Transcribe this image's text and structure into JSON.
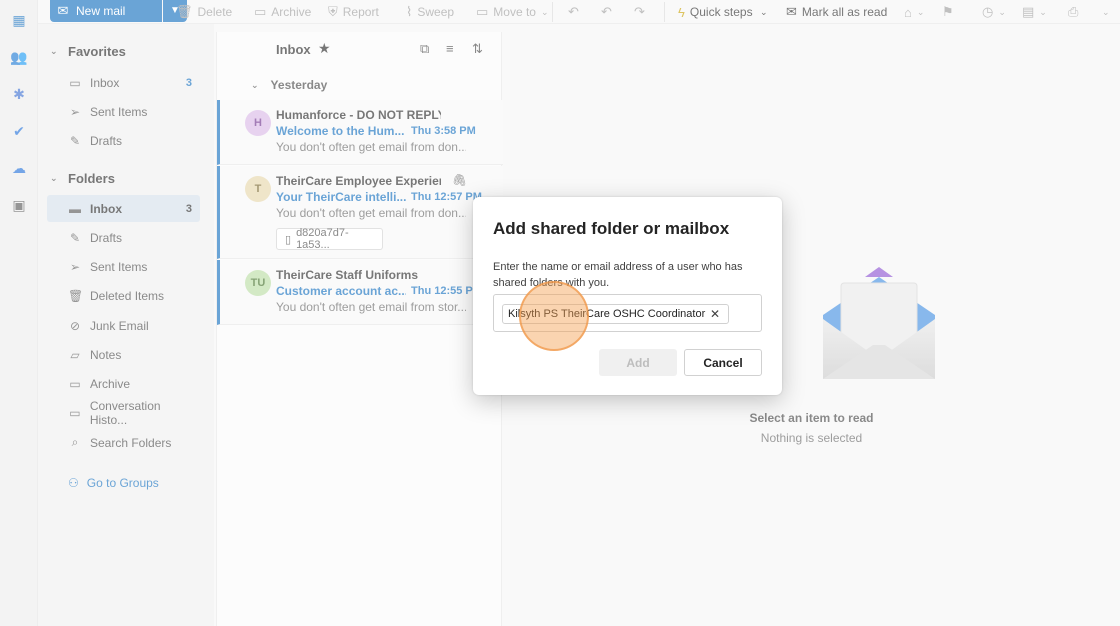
{
  "toolbar": {
    "new_mail": "New mail",
    "delete": "Delete",
    "archive": "Archive",
    "report": "Report",
    "sweep": "Sweep",
    "move_to": "Move to",
    "quick_steps": "Quick steps",
    "mark_all_read": "Mark all as read"
  },
  "nav": {
    "favorites_label": "Favorites",
    "favorites": [
      {
        "label": "Inbox",
        "count": "3"
      },
      {
        "label": "Sent Items"
      },
      {
        "label": "Drafts"
      }
    ],
    "folders_label": "Folders",
    "folders": [
      {
        "label": "Inbox",
        "count": "3"
      },
      {
        "label": "Drafts"
      },
      {
        "label": "Sent Items"
      },
      {
        "label": "Deleted Items"
      },
      {
        "label": "Junk Email"
      },
      {
        "label": "Notes"
      },
      {
        "label": "Archive"
      },
      {
        "label": "Conversation Histo..."
      },
      {
        "label": "Search Folders"
      }
    ],
    "go_to_groups": "Go to Groups"
  },
  "list": {
    "title": "Inbox",
    "group_label": "Yesterday",
    "messages": [
      {
        "initials": "H",
        "sender": "Humanforce - DO NOT REPLY",
        "subject": "Welcome to the Hum...",
        "time": "Thu 3:58 PM",
        "preview": "You don't often get email from don..."
      },
      {
        "initials": "T",
        "sender": "TheirCare Employee Experien...",
        "subject": "Your TheirCare intelli...",
        "time": "Thu 12:57 PM",
        "preview": "You don't often get email from don...",
        "attachment": "d820a7d7-1a53..."
      },
      {
        "initials": "TU",
        "sender": "TheirCare Staff Uniforms",
        "subject": "Customer account ac...",
        "time": "Thu 12:55 PM",
        "preview": "You don't often get email from stor..."
      }
    ]
  },
  "reading": {
    "title": "Select an item to read",
    "subtitle": "Nothing is selected"
  },
  "dialog": {
    "title": "Add shared folder or mailbox",
    "description": "Enter the name or email address of a user who has shared folders with you.",
    "selected_value": "Kilsyth PS TheirCare OSHC Coordinator",
    "add_label": "Add",
    "cancel_label": "Cancel"
  },
  "colors": {
    "accent": "#0f6cbd",
    "avatar_h": "#c9a0dc",
    "avatar_t": "#d9c48a",
    "avatar_tu": "#a8cf8e"
  }
}
